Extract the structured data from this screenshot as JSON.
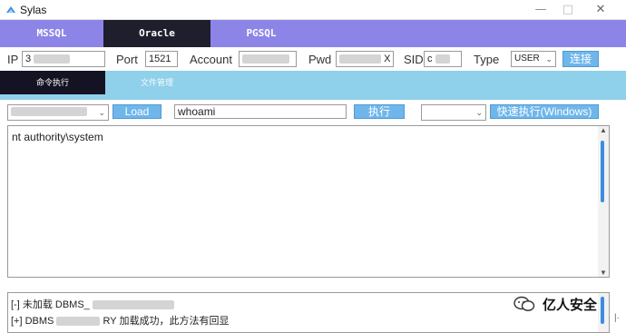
{
  "window": {
    "title": "Sylas"
  },
  "db_tabs": [
    {
      "label": "MSSQL",
      "active": false
    },
    {
      "label": "Oracle",
      "active": true
    },
    {
      "label": "PGSQL",
      "active": false
    }
  ],
  "connection": {
    "ip_label": "IP",
    "ip_value": "3",
    "port_label": "Port",
    "port_value": "1521",
    "account_label": "Account",
    "pwd_label": "Pwd",
    "pwd_value": "X",
    "sid_label": "SID",
    "sid_value": "c",
    "type_label": "Type",
    "type_value": "USER",
    "connect_label": "连接"
  },
  "func_tabs": [
    {
      "label": "命令执行",
      "active": true
    },
    {
      "label": "文件管理",
      "active": false
    }
  ],
  "command": {
    "load_label": "Load",
    "input_value": "whoami",
    "exec_label": "执行",
    "quick_exec_label": "快速执行(Windows)"
  },
  "output": {
    "text": "nt authority\\system"
  },
  "log": {
    "line1_prefix": "[-] 未加载 DBMS_",
    "line2_prefix": "[+] DBMS",
    "line2_suffix": "RY 加载成功，此方法有回显"
  },
  "watermark": {
    "text": "亿人安全"
  },
  "colors": {
    "db_tab_bg": "#8d84e8",
    "db_tab_active": "#1e1e2c",
    "func_tab_bg": "#8fd0ea",
    "func_tab_active": "#131323",
    "button_blue": "#6fb6ea",
    "scroll_thumb": "#3c8de0"
  }
}
